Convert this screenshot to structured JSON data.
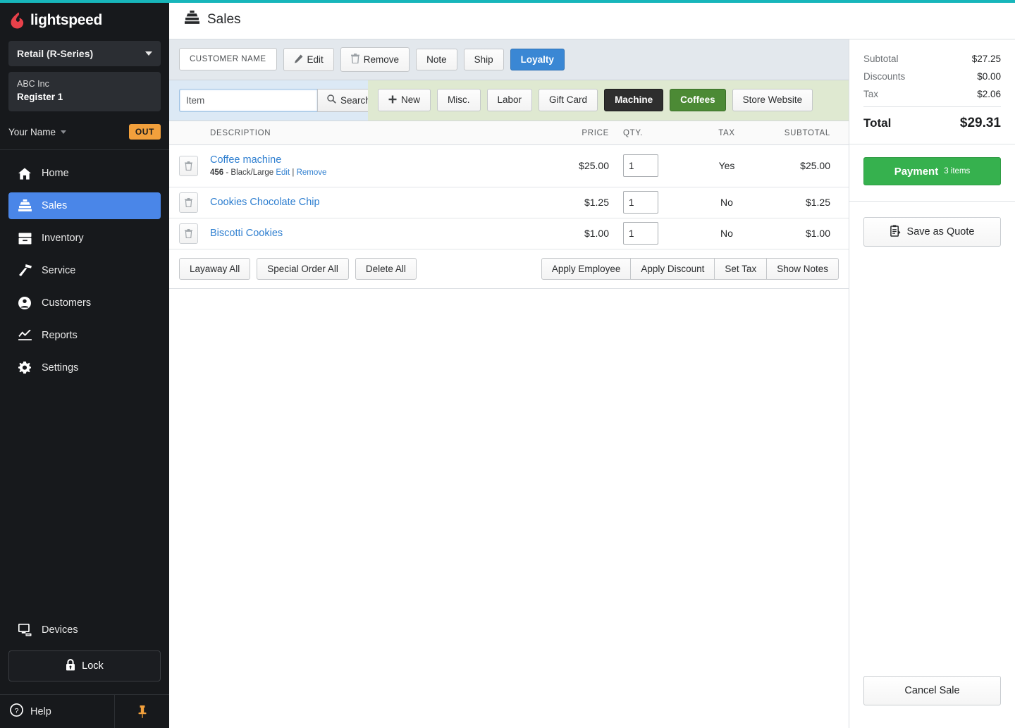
{
  "brand": {
    "logo_text": "lightspeed",
    "logo_color": "#e8414a",
    "accent_top_color": "#17b6bb"
  },
  "sidebar": {
    "series_selector": {
      "label": "Retail (R-Series)",
      "icon": "chevron-down-icon"
    },
    "store": {
      "company": "ABC Inc",
      "register": "Register 1"
    },
    "user": {
      "name": "Your Name",
      "status_badge": "OUT",
      "badge_color": "#f2a03c"
    },
    "nav_items": [
      {
        "label": "Home",
        "icon": "home-icon",
        "active": false
      },
      {
        "label": "Sales",
        "icon": "cash-register-icon",
        "active": true
      },
      {
        "label": "Inventory",
        "icon": "inventory-box-icon",
        "active": false
      },
      {
        "label": "Service",
        "icon": "hammer-icon",
        "active": false
      },
      {
        "label": "Customers",
        "icon": "person-circle-icon",
        "active": false
      },
      {
        "label": "Reports",
        "icon": "line-chart-icon",
        "active": false
      },
      {
        "label": "Settings",
        "icon": "gear-icon",
        "active": false
      }
    ],
    "devices": {
      "label": "Devices",
      "icon": "monitor-icon"
    },
    "lock": {
      "label": "Lock",
      "icon": "lock-icon"
    },
    "help": {
      "label": "Help",
      "icon": "question-circle-icon"
    },
    "pin": {
      "icon": "pin-icon",
      "color": "#f2a03c"
    },
    "active_color": "#4a86e8"
  },
  "header": {
    "title": "Sales",
    "icon": "cash-register-icon"
  },
  "customer_toolbar": {
    "customer_name_placeholder": "CUSTOMER NAME",
    "buttons": [
      {
        "label": "Edit",
        "icon": "pencil-icon",
        "style": "default"
      },
      {
        "label": "Remove",
        "icon": "trash-icon",
        "style": "default"
      },
      {
        "label": "Note",
        "icon": "",
        "style": "default"
      },
      {
        "label": "Ship",
        "icon": "",
        "style": "default"
      },
      {
        "label": "Loyalty",
        "icon": "",
        "style": "blue"
      }
    ]
  },
  "search_toolbar": {
    "input_value": "",
    "input_placeholder": "Item",
    "search_button_label": "Search",
    "search_icon": "search-icon",
    "quick_buttons": [
      {
        "label": "New",
        "icon": "plus-icon",
        "style": "default"
      },
      {
        "label": "Misc.",
        "icon": "",
        "style": "default"
      },
      {
        "label": "Labor",
        "icon": "",
        "style": "default"
      },
      {
        "label": "Gift Card",
        "icon": "",
        "style": "default"
      },
      {
        "label": "Machine",
        "icon": "",
        "style": "dark"
      },
      {
        "label": "Coffees",
        "icon": "",
        "style": "green"
      },
      {
        "label": "Store Website",
        "icon": "",
        "style": "default"
      }
    ]
  },
  "line_items": {
    "columns": [
      "DESCRIPTION",
      "PRICE",
      "QTY.",
      "TAX",
      "SUBTOTAL"
    ],
    "rows": [
      {
        "name": "Coffee machine",
        "sku": "456",
        "variant": "Black/Large",
        "edit_label": "Edit",
        "separator": "|",
        "remove_label": "Remove",
        "price": "$25.00",
        "qty": "1",
        "tax": "Yes",
        "subtotal": "$25.00"
      },
      {
        "name": "Cookies Chocolate Chip",
        "sku": "",
        "variant": "",
        "price": "$1.25",
        "qty": "1",
        "tax": "No",
        "subtotal": "$1.25"
      },
      {
        "name": "Biscotti Cookies",
        "sku": "",
        "variant": "",
        "price": "$1.00",
        "qty": "1",
        "tax": "No",
        "subtotal": "$1.00"
      }
    ]
  },
  "bulk_actions": {
    "left": [
      "Layaway All",
      "Special Order All",
      "Delete All"
    ],
    "right": [
      "Apply Employee",
      "Apply Discount",
      "Set Tax",
      "Show Notes"
    ]
  },
  "totals": {
    "rows": [
      {
        "label": "Subtotal",
        "value": "$27.25"
      },
      {
        "label": "Discounts",
        "value": "$0.00"
      },
      {
        "label": "Tax",
        "value": "$2.06"
      }
    ],
    "grand_label": "Total",
    "grand_value": "$29.31"
  },
  "actions": {
    "payment_label": "Payment",
    "payment_count": "3 items",
    "payment_color": "#36b14e",
    "save_quote_label": "Save as Quote",
    "save_quote_icon": "clipboard-icon",
    "cancel_label": "Cancel Sale"
  }
}
